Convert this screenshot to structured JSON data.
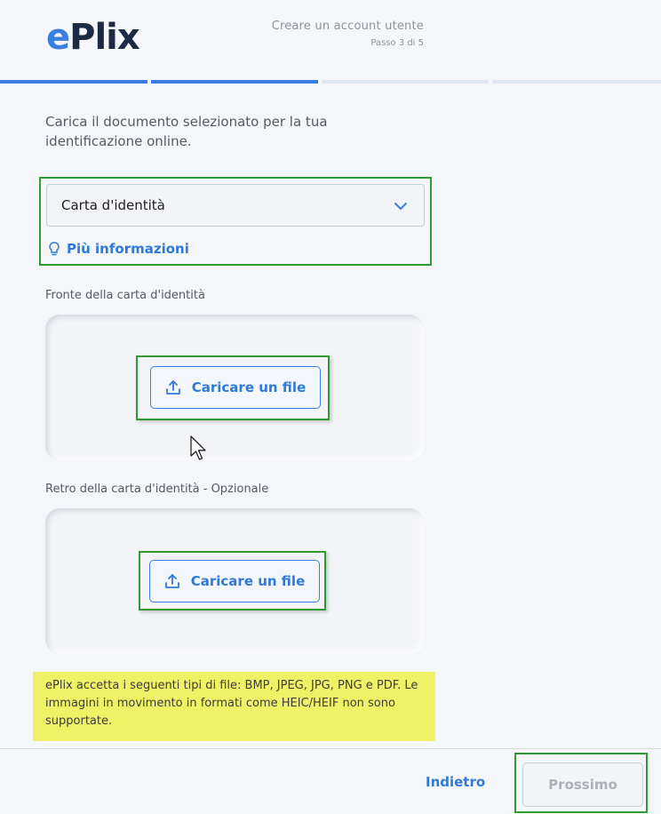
{
  "logo": {
    "e": "e",
    "plix": "Plix"
  },
  "header": {
    "title": "Creare un account utente",
    "step": "Passo 3 di 5"
  },
  "progress": {
    "total_steps": 5,
    "current_step": 3
  },
  "intro": "Carica il documento selezionato per la tua identificazione online.",
  "document_select": {
    "value": "Carta d'identità",
    "info_link": "Più informazioni"
  },
  "front": {
    "label": "Fronte della carta d'identità",
    "upload_label": "Caricare un file"
  },
  "back": {
    "label": "Retro della carta d'identità - Opzionale",
    "upload_label": "Caricare un file"
  },
  "notice": "ePlix accetta i seguenti tipi di file: BMP, JPEG, JPG, PNG e PDF. Le immagini in movimento in formati come HEIC/HEIF non sono supportate.",
  "footer": {
    "back_label": "Indietro",
    "next_label": "Prossimo"
  },
  "colors": {
    "accent": "#3a7fe0",
    "link": "#2f7ad8",
    "notice_bg": "#eff266",
    "highlight_border": "#2f9a2f"
  },
  "icons": [
    "chevron-down-icon",
    "lightbulb-icon",
    "upload-icon",
    "mouse-cursor-icon"
  ]
}
